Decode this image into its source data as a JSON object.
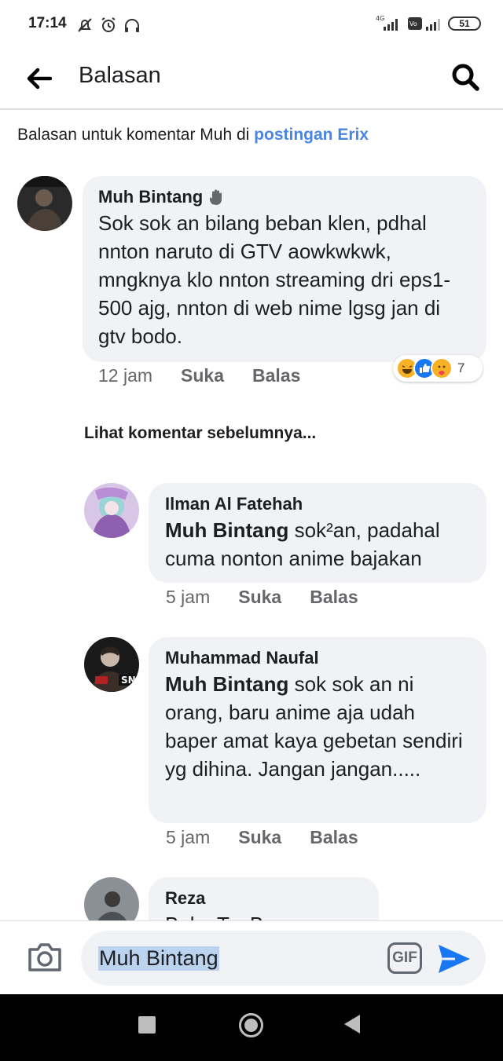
{
  "status_bar": {
    "time": "17:14",
    "battery": "51",
    "icons": [
      "silent-icon",
      "alarm-icon",
      "headphones-icon",
      "4g-signal-icon",
      "volte-signal-icon",
      "battery-icon"
    ]
  },
  "header": {
    "title": "Balasan",
    "icons": [
      "back-arrow-icon",
      "search-icon"
    ]
  },
  "context": {
    "prefix": "Balasan untuk komentar Muh di ",
    "link": "postingan Erix"
  },
  "main_comment": {
    "author": "Muh Bintang",
    "badge_icon": "waving-hand-icon",
    "text": "Sok sok an bilang beban klen, pdhal nnton naruto di GTV aowkwkwk, mngknya klo nnton streaming dri eps1-500 ajg, nnton  di web nime lgsg jan di gtv bodo.",
    "time": "12 jam",
    "like": "Suka",
    "reply": "Balas",
    "reactions": [
      "haha",
      "like",
      "care"
    ],
    "reaction_count": "7"
  },
  "see_previous": "Lihat komentar sebelumnya...",
  "replies": [
    {
      "author": "Ilman Al Fatehah",
      "mention": "Muh Bintang",
      "text": " sok²an, padahal cuma nonton anime bajakan",
      "time": "5 jam",
      "like": "Suka",
      "reply": "Balas"
    },
    {
      "author": "Muhammad Naufal",
      "mention": "Muh Bintang",
      "text": " sok sok an ni orang, baru anime aja udah baper amat kaya gebetan sendiri yg dihina. Jangan jangan.....",
      "time": "5 jam",
      "like": "Suka",
      "reply": "Balas"
    },
    {
      "author": "Reza",
      "text": "Bal... T... B...",
      "time": "",
      "like": "",
      "reply": ""
    }
  ],
  "composer": {
    "input_value": "Muh Bintang",
    "gif_label": "GIF",
    "icons": [
      "camera-icon",
      "gif-icon",
      "send-icon"
    ]
  },
  "nav_bar": {
    "icons": [
      "recents-icon",
      "home-icon",
      "back-icon"
    ]
  },
  "colors": {
    "link_blue": "#4a86e0",
    "bubble_bg": "#f0f2f5",
    "meta_gray": "#65676b",
    "send_blue": "#1877f2"
  }
}
